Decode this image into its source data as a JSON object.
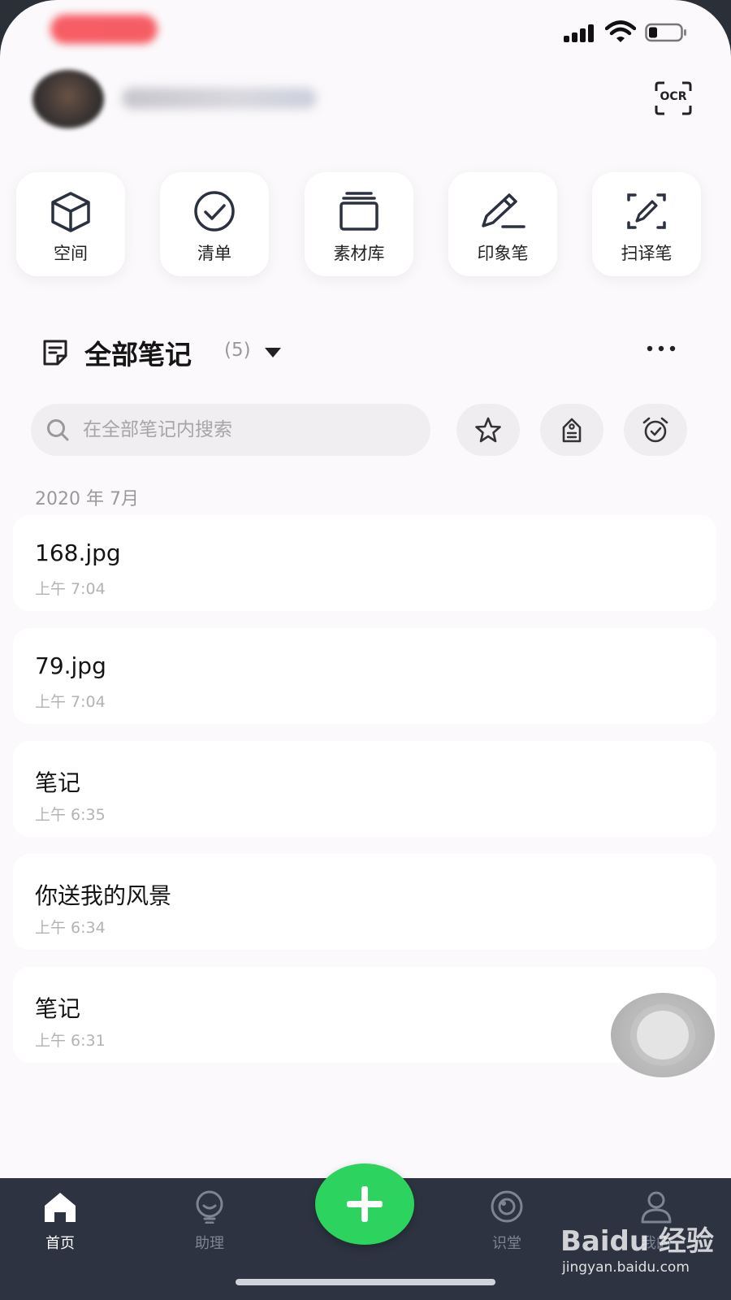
{
  "status_bar": {
    "recording_indicator": "",
    "signal": "4 bars",
    "wifi": "on",
    "battery_level": 0.25
  },
  "header": {
    "avatar": "avatar",
    "ocr_label": "OCR"
  },
  "shortcuts": [
    {
      "label": "空间",
      "icon": "cube-icon"
    },
    {
      "label": "清单",
      "icon": "check-circle-icon"
    },
    {
      "label": "素材库",
      "icon": "stack-icon"
    },
    {
      "label": "印象笔",
      "icon": "pen-icon"
    },
    {
      "label": "扫译笔",
      "icon": "scan-pen-icon"
    }
  ],
  "notes": {
    "title": "全部笔记",
    "count": "(5)",
    "search_placeholder": "在全部笔记内搜索",
    "section_date": "2020 年 7月",
    "items": [
      {
        "title": "168.jpg",
        "time": "上午 7:04"
      },
      {
        "title": "79.jpg",
        "time": "上午 7:04"
      },
      {
        "title": "笔记",
        "time": "上午 6:35"
      },
      {
        "title": "你送我的风景",
        "time": "上午 6:34"
      },
      {
        "title": "笔记",
        "time": "上午 6:31"
      }
    ]
  },
  "tabbar": {
    "tabs": [
      {
        "label": "首页",
        "icon": "home-icon",
        "active": true
      },
      {
        "label": "助理",
        "icon": "assistant-icon",
        "active": false
      },
      {
        "label": "识堂",
        "icon": "classroom-icon",
        "active": false
      },
      {
        "label": "我的",
        "icon": "profile-icon",
        "active": false
      }
    ]
  },
  "watermark": {
    "brand": "Baidu 经验",
    "url": "jingyan.baidu.com"
  },
  "colors": {
    "accent": "#2cd35e",
    "tabbar_bg": "#2d3340",
    "page_bg": "#fbf9fb"
  }
}
